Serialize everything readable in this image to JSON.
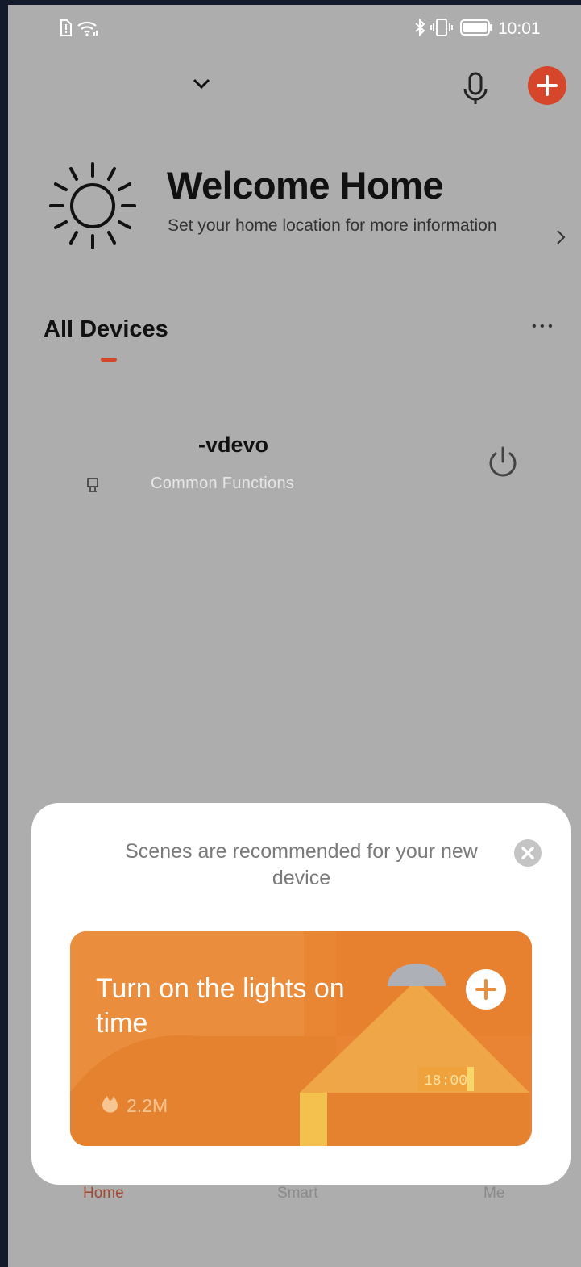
{
  "status_bar": {
    "time": "10:01",
    "icons": [
      "sim-alert-icon",
      "wifi-icon",
      "bluetooth-icon",
      "vibrate-icon",
      "battery-icon"
    ]
  },
  "header": {
    "home_selector_icon": "chevron-down-icon",
    "mic_icon": "microphone-icon",
    "add_icon": "plus-icon",
    "accent_color": "#d5462a"
  },
  "welcome": {
    "icon": "sun-icon",
    "title": "Welcome Home",
    "subtitle": "Set your home location for more information"
  },
  "devices": {
    "section_title": "All Devices",
    "more_label": "• • •",
    "items": [
      {
        "name": "-vdevo",
        "subtitle": "Common Functions",
        "power_icon": "power-icon"
      }
    ]
  },
  "bottom_nav": {
    "items": [
      {
        "label": "Home",
        "active": true
      },
      {
        "label": "Smart",
        "active": false
      },
      {
        "label": "Me",
        "active": false
      }
    ]
  },
  "recommend_sheet": {
    "title": "Scenes are recommended for your new device",
    "close_icon": "close-icon",
    "card": {
      "title": "Turn on the lights on time",
      "count": "2.2M",
      "count_icon": "flame-icon",
      "clock_text": "18:00",
      "add_icon": "plus-icon",
      "color": "#ea8d3c"
    }
  }
}
